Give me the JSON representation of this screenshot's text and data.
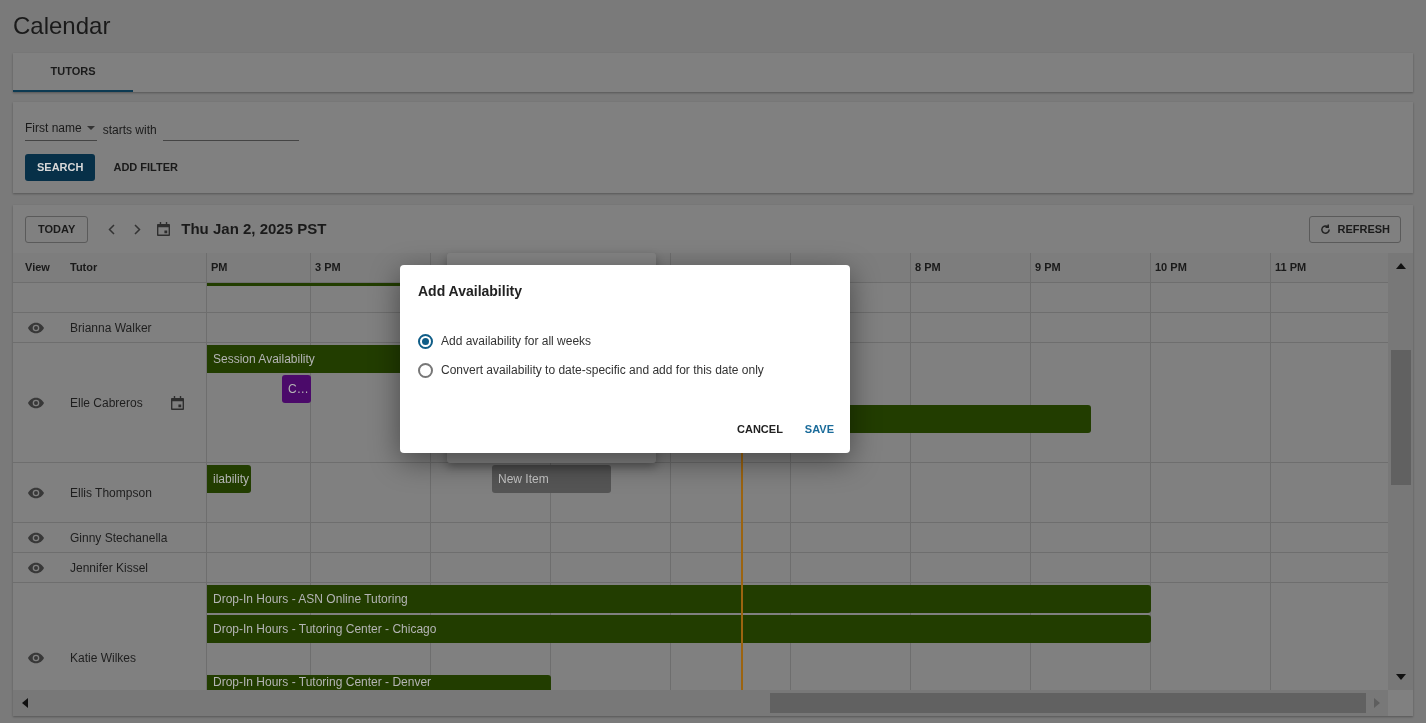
{
  "page": {
    "title": "Calendar"
  },
  "tabs": [
    {
      "label": "TUTORS",
      "selected": true
    }
  ],
  "filter": {
    "field": "First name",
    "operator": "starts with",
    "search_button": "SEARCH",
    "add_filter_button": "ADD FILTER"
  },
  "toolbar": {
    "today_button": "TODAY",
    "date": "Thu Jan 2, 2025 PST",
    "refresh_button": "REFRESH"
  },
  "grid": {
    "columns": [
      "View",
      "Tutor"
    ],
    "hours": [
      "PM",
      "3 PM",
      "8 PM",
      "9 PM",
      "10 PM",
      "11 PM"
    ],
    "rows": [
      {
        "events": [
          {
            "kind": "strip",
            "color": "#223d00"
          }
        ]
      },
      {
        "name": "Brianna Walker",
        "date_specific": false,
        "events": []
      },
      {
        "name": "Elle Cabreros",
        "date_specific": true,
        "events": [
          {
            "kind": "bar",
            "label": "Session Availability",
            "color": "#223d00"
          },
          {
            "kind": "bar",
            "label": "C…",
            "color": "#4b0a6a"
          },
          {
            "kind": "bar",
            "color": "#223d00"
          }
        ]
      },
      {
        "name": "Ellis Thompson",
        "date_specific": false,
        "events": [
          {
            "kind": "bar",
            "label": "ilability",
            "color": "#223d00"
          },
          {
            "kind": "bar",
            "label": "New Item",
            "color": "#555555"
          }
        ]
      },
      {
        "name": "Ginny Stechanella",
        "date_specific": false,
        "events": []
      },
      {
        "name": "Jennifer Kissel",
        "date_specific": false,
        "events": []
      },
      {
        "name": "Katie Wilkes",
        "date_specific": false,
        "events": [
          {
            "kind": "bar",
            "label": "Drop-In Hours - ASN Online Tutoring",
            "color": "#223d00"
          },
          {
            "kind": "bar",
            "label": "Drop-In Hours - Tutoring Center - Chicago",
            "color": "#223d00"
          },
          {
            "kind": "bar",
            "label": "Drop-In Hours - Tutoring Center - Denver",
            "color": "#223d00"
          }
        ]
      }
    ]
  },
  "dialog": {
    "title": "Add Availability",
    "options": [
      {
        "label": "Add availability for all weeks",
        "selected": true
      },
      {
        "label": "Convert availability to date-specific and add for this date only",
        "selected": false
      }
    ],
    "buttons": [
      {
        "label": "CANCEL",
        "kind": "plain"
      },
      {
        "label": "SAVE",
        "kind": "primary"
      }
    ]
  }
}
